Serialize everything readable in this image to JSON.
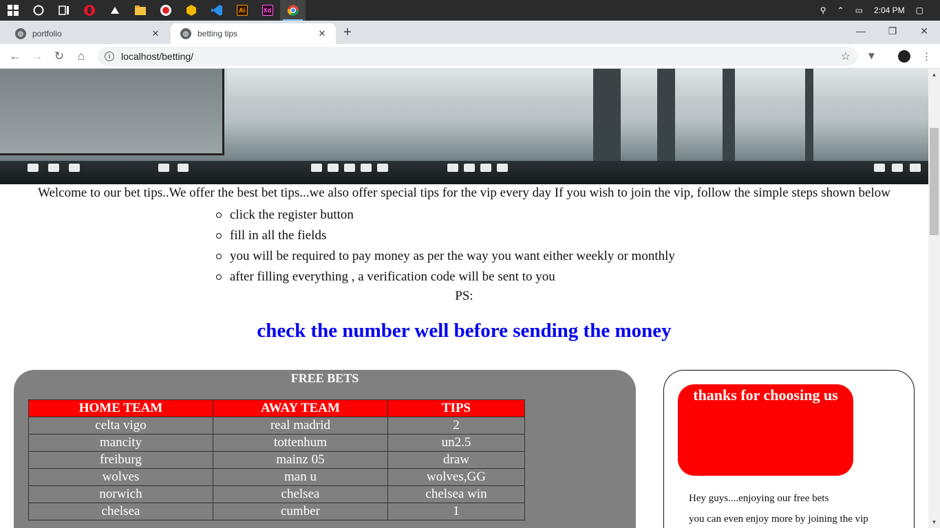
{
  "taskbar": {
    "icons": [
      "windows-start",
      "cortana",
      "task-view",
      "opera",
      "mouse-app",
      "file-explorer",
      "record",
      "cube-app",
      "vscode",
      "illustrator",
      "xd",
      "chrome"
    ],
    "illustrator_label": "Ai",
    "xd_label": "Xd",
    "time": "2:04 PM"
  },
  "tabs": [
    {
      "title": "portfolio"
    },
    {
      "title": "betting tips"
    }
  ],
  "address": {
    "url": "localhost/betting/"
  },
  "page": {
    "welcome": "Welcome to our bet tips..We offer the best bet tips...we also offer special tips for the vip every day If you wish to join the vip, follow the simple steps shown below",
    "steps": [
      "click the register button",
      "fill in all the fields",
      "you will be required to pay money as per the way you want either weekly or monthly",
      "after filling everything , a verification code will be sent to you"
    ],
    "ps": "PS:",
    "warning": "check the number well before sending the money",
    "free_bets": {
      "heading": "FREE BETS",
      "columns": [
        "HOME TEAM",
        "AWAY TEAM",
        "TIPS"
      ],
      "rows": [
        [
          "celta vigo",
          "real madrid",
          "2"
        ],
        [
          "mancity",
          "tottenhum",
          "un2.5"
        ],
        [
          "freiburg",
          "mainz 05",
          "draw"
        ],
        [
          "wolves",
          "man u",
          "wolves,GG"
        ],
        [
          "norwich",
          "chelsea",
          "chelsea win"
        ],
        [
          "chelsea",
          "cumber",
          "1"
        ]
      ]
    },
    "vip": {
      "title": "thanks for choosing us",
      "line1": "Hey guys....enjoying our free bets",
      "line2": "you can even enjoy more by joining the vip"
    }
  },
  "colors": {
    "warning": "#0000ee",
    "table_header": "#ff0000",
    "panel": "#808080"
  }
}
